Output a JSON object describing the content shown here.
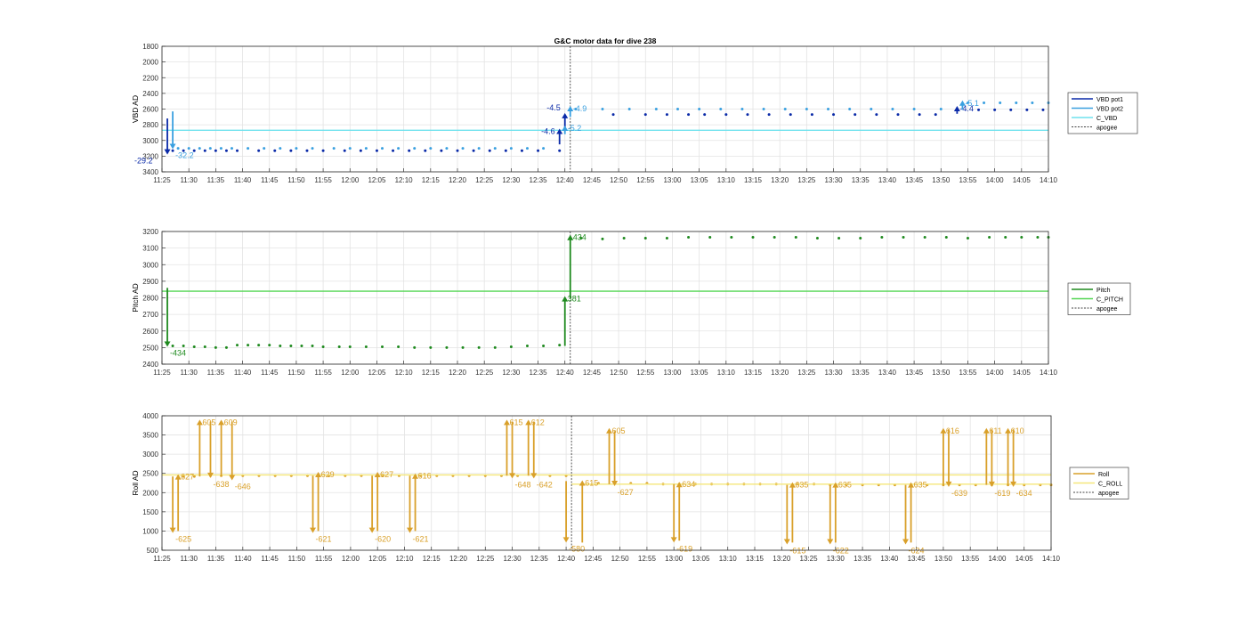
{
  "figure_title": "G&C motor data for dive 238",
  "colors": {
    "vbd_pot1": "#0a2aa8",
    "vbd_pot2": "#3aa0e0",
    "c_vbd": "#6fe2ee",
    "pitch": "#1f8a1f",
    "c_pitch": "#55d655",
    "roll": "#d9a02a",
    "c_roll": "#f5e77a",
    "apogee": "#444444",
    "grid": "#e3e3e3"
  },
  "chart_data": [
    {
      "id": "vbd",
      "type": "scatter",
      "ylabel": "VBD AD",
      "ylim": [
        1800,
        3400
      ],
      "y_reversed": true,
      "yticks": [
        1800,
        2000,
        2200,
        2400,
        2600,
        2800,
        3000,
        3200,
        3400
      ],
      "xlim": [
        "11:25",
        "14:10"
      ],
      "grid": true,
      "legend_placement": "right",
      "legend": [
        "VBD pot1",
        "VBD pot2",
        "C_VBD",
        "apogee"
      ],
      "series": [
        {
          "name": "VBD pot1",
          "x": [
            "11:27",
            "11:29",
            "11:31",
            "11:33",
            "11:35",
            "11:37",
            "11:39",
            "11:43",
            "11:46",
            "11:49",
            "11:52",
            "11:55",
            "11:59",
            "12:02",
            "12:05",
            "12:08",
            "12:11",
            "12:14",
            "12:17",
            "12:20",
            "12:23",
            "12:26",
            "12:29",
            "12:32",
            "12:35",
            "12:39",
            "12:49",
            "12:55",
            "12:59",
            "13:03",
            "13:06",
            "13:10",
            "13:14",
            "13:18",
            "13:22",
            "13:26",
            "13:30",
            "13:34",
            "13:38",
            "13:42",
            "13:46",
            "13:49",
            "13:53",
            "13:57",
            "14:00",
            "14:03",
            "14:06",
            "14:09"
          ],
          "y": [
            3130,
            3130,
            3130,
            3130,
            3130,
            3130,
            3130,
            3130,
            3130,
            3130,
            3130,
            3130,
            3130,
            3130,
            3130,
            3130,
            3130,
            3130,
            3130,
            3130,
            3130,
            3130,
            3130,
            3130,
            3130,
            3130,
            2670,
            2670,
            2670,
            2670,
            2670,
            2670,
            2670,
            2670,
            2670,
            2670,
            2670,
            2670,
            2670,
            2670,
            2670,
            2670,
            2610,
            2610,
            2610,
            2610,
            2610,
            2610
          ]
        },
        {
          "name": "VBD pot2",
          "x": [
            "11:28",
            "11:30",
            "11:32",
            "11:34",
            "11:36",
            "11:38",
            "11:41",
            "11:44",
            "11:47",
            "11:50",
            "11:53",
            "11:57",
            "12:00",
            "12:03",
            "12:06",
            "12:09",
            "12:12",
            "12:15",
            "12:18",
            "12:21",
            "12:24",
            "12:27",
            "12:30",
            "12:33",
            "12:36",
            "12:42",
            "12:47",
            "12:52",
            "12:57",
            "13:01",
            "13:05",
            "13:09",
            "13:13",
            "13:17",
            "13:21",
            "13:25",
            "13:29",
            "13:33",
            "13:37",
            "13:41",
            "13:45",
            "13:50",
            "13:55",
            "13:58",
            "14:01",
            "14:04",
            "14:07",
            "14:10"
          ],
          "y": [
            3100,
            3100,
            3100,
            3100,
            3100,
            3100,
            3100,
            3100,
            3100,
            3100,
            3100,
            3100,
            3100,
            3100,
            3100,
            3100,
            3100,
            3100,
            3100,
            3100,
            3100,
            3100,
            3100,
            3100,
            3100,
            2600,
            2600,
            2600,
            2600,
            2600,
            2600,
            2600,
            2600,
            2600,
            2600,
            2600,
            2600,
            2600,
            2600,
            2600,
            2600,
            2600,
            2520,
            2520,
            2520,
            2520,
            2520,
            2520
          ]
        },
        {
          "name": "C_VBD",
          "x": [
            "11:25",
            "14:10"
          ],
          "y": [
            2870,
            2870
          ]
        }
      ],
      "arrows": [
        {
          "series": "VBD pot1",
          "x": "11:26",
          "from": 2720,
          "to": 3180,
          "label": "-29.2"
        },
        {
          "series": "VBD pot2",
          "x": "11:27",
          "from": 2630,
          "to": 3110,
          "label": "-32.2"
        },
        {
          "series": "VBD pot1",
          "x": "12:39",
          "from": 3050,
          "to": 2850,
          "label": "-4.6"
        },
        {
          "series": "VBD pot1",
          "x": "12:40",
          "from": 2880,
          "to": 2650,
          "label": "-4.5"
        },
        {
          "series": "VBD pot2",
          "x": "12:40",
          "from": 2920,
          "to": 2810,
          "label": "-5.2"
        },
        {
          "series": "VBD pot2",
          "x": "12:41",
          "from": 2700,
          "to": 2560,
          "label": "-4.9"
        },
        {
          "series": "VBD pot1",
          "x": "13:53",
          "from": 2660,
          "to": 2560,
          "label": "-4.4"
        },
        {
          "series": "VBD pot2",
          "x": "13:54",
          "from": 2610,
          "to": 2490,
          "label": "-5.1"
        }
      ],
      "apogee_x": "12:41"
    },
    {
      "id": "pitch",
      "type": "scatter",
      "ylabel": "Pitch AD",
      "ylim": [
        2400,
        3200
      ],
      "yticks": [
        2400,
        2500,
        2600,
        2700,
        2800,
        2900,
        3000,
        3100,
        3200
      ],
      "xlim": [
        "11:25",
        "14:10"
      ],
      "grid": true,
      "legend_placement": "right",
      "legend": [
        "Pitch",
        "C_PITCH",
        "apogee"
      ],
      "series": [
        {
          "name": "Pitch",
          "x": [
            "11:27",
            "11:29",
            "11:31",
            "11:33",
            "11:35",
            "11:37",
            "11:39",
            "11:41",
            "11:43",
            "11:45",
            "11:47",
            "11:49",
            "11:51",
            "11:53",
            "11:55",
            "11:58",
            "12:00",
            "12:03",
            "12:06",
            "12:09",
            "12:12",
            "12:15",
            "12:18",
            "12:21",
            "12:24",
            "12:27",
            "12:30",
            "12:33",
            "12:36",
            "12:39",
            "12:43",
            "12:47",
            "12:51",
            "12:55",
            "12:59",
            "13:03",
            "13:07",
            "13:11",
            "13:15",
            "13:19",
            "13:23",
            "13:27",
            "13:31",
            "13:35",
            "13:39",
            "13:43",
            "13:47",
            "13:51",
            "13:55",
            "13:59",
            "14:02",
            "14:05",
            "14:08",
            "14:10"
          ],
          "y": [
            2510,
            2510,
            2505,
            2505,
            2500,
            2500,
            2515,
            2515,
            2515,
            2515,
            2510,
            2510,
            2510,
            2510,
            2505,
            2505,
            2505,
            2505,
            2505,
            2505,
            2500,
            2500,
            2500,
            2500,
            2500,
            2500,
            2505,
            2510,
            2510,
            2515,
            3160,
            3155,
            3160,
            3160,
            3160,
            3165,
            3165,
            3165,
            3165,
            3165,
            3165,
            3160,
            3160,
            3160,
            3165,
            3165,
            3165,
            3165,
            3160,
            3165,
            3165,
            3165,
            3165,
            3165
          ]
        },
        {
          "name": "C_PITCH",
          "x": [
            "11:25",
            "14:10"
          ],
          "y": [
            2840,
            2840
          ]
        }
      ],
      "arrows": [
        {
          "x": "11:26",
          "from": 2860,
          "to": 2505,
          "label": "-434"
        },
        {
          "x": "12:40",
          "from": 2510,
          "to": 2810,
          "label": "381"
        },
        {
          "x": "12:41",
          "from": 2800,
          "to": 3180,
          "label": "434"
        }
      ],
      "apogee_x": "12:41"
    },
    {
      "id": "roll",
      "type": "scatter",
      "ylabel": "Roll AD",
      "ylim": [
        500,
        4000
      ],
      "yticks": [
        500,
        1000,
        1500,
        2000,
        2500,
        3000,
        3500,
        4000
      ],
      "xlim": [
        "11:25",
        "14:10"
      ],
      "grid": true,
      "legend_placement": "right",
      "legend": [
        "Roll",
        "C_ROLL",
        "apogee"
      ],
      "series": [
        {
          "name": "Roll",
          "x": [
            "11:29",
            "11:31",
            "11:34",
            "11:36",
            "11:40",
            "11:43",
            "11:46",
            "11:49",
            "11:52",
            "11:56",
            "11:59",
            "12:02",
            "12:06",
            "12:09",
            "12:13",
            "12:16",
            "12:19",
            "12:22",
            "12:25",
            "12:28",
            "12:31",
            "12:34",
            "12:37",
            "12:40",
            "12:46",
            "12:49",
            "12:52",
            "12:55",
            "12:58",
            "13:01",
            "13:04",
            "13:07",
            "13:10",
            "13:13",
            "13:16",
            "13:19",
            "13:23",
            "13:26",
            "13:29",
            "13:32",
            "13:35",
            "13:38",
            "13:41",
            "13:44",
            "13:47",
            "13:50",
            "13:53",
            "13:56",
            "13:59",
            "14:02",
            "14:05",
            "14:08",
            "14:10"
          ],
          "y": [
            2420,
            2420,
            2440,
            2440,
            2440,
            2440,
            2440,
            2440,
            2440,
            2440,
            2440,
            2440,
            2440,
            2440,
            2440,
            2440,
            2440,
            2440,
            2440,
            2440,
            2440,
            2440,
            2440,
            2440,
            2240,
            2240,
            2240,
            2240,
            2220,
            2220,
            2220,
            2220,
            2220,
            2220,
            2220,
            2220,
            2220,
            2220,
            2200,
            2200,
            2200,
            2200,
            2200,
            2200,
            2200,
            2200,
            2200,
            2200,
            2200,
            2200,
            2200,
            2200,
            2200
          ]
        },
        {
          "name": "C_ROLL",
          "x": [
            "11:25",
            "14:10"
          ],
          "y": [
            2460,
            2460
          ]
        },
        {
          "name": "C_ROLL",
          "x": [
            "12:41",
            "14:10"
          ],
          "y": [
            2220,
            2220
          ]
        }
      ],
      "arrows": [
        {
          "x": "11:27",
          "from": 2420,
          "to": 950,
          "label": "-625"
        },
        {
          "x": "11:28",
          "from": 1000,
          "to": 2480,
          "label": "627"
        },
        {
          "x": "11:32",
          "from": 2420,
          "to": 3900,
          "label": "605"
        },
        {
          "x": "11:34",
          "from": 3850,
          "to": 2380,
          "label": "-638"
        },
        {
          "x": "11:36",
          "from": 2420,
          "to": 3900,
          "label": "609"
        },
        {
          "x": "11:38",
          "from": 3850,
          "to": 2320,
          "label": "-646"
        },
        {
          "x": "11:53",
          "from": 2440,
          "to": 950,
          "label": "-621"
        },
        {
          "x": "11:54",
          "from": 1000,
          "to": 2540,
          "label": "629"
        },
        {
          "x": "12:04",
          "from": 2440,
          "to": 950,
          "label": "-620"
        },
        {
          "x": "12:05",
          "from": 1000,
          "to": 2540,
          "label": "627"
        },
        {
          "x": "12:11",
          "from": 2440,
          "to": 950,
          "label": "-621"
        },
        {
          "x": "12:12",
          "from": 1000,
          "to": 2500,
          "label": "616"
        },
        {
          "x": "12:29",
          "from": 2440,
          "to": 3900,
          "label": "615"
        },
        {
          "x": "12:30",
          "from": 3850,
          "to": 2370,
          "label": "-648"
        },
        {
          "x": "12:33",
          "from": 2440,
          "to": 3900,
          "label": "612"
        },
        {
          "x": "12:34",
          "from": 3850,
          "to": 2370,
          "label": "-642"
        },
        {
          "x": "12:40",
          "from": 2300,
          "to": 700,
          "label": "-580"
        },
        {
          "x": "12:43",
          "from": 700,
          "to": 2320,
          "label": "615"
        },
        {
          "x": "12:48",
          "from": 2220,
          "to": 3680,
          "label": "605"
        },
        {
          "x": "12:49",
          "from": 3600,
          "to": 2170,
          "label": "-627"
        },
        {
          "x": "13:00",
          "from": 2220,
          "to": 700,
          "label": "-619"
        },
        {
          "x": "13:01",
          "from": 750,
          "to": 2280,
          "label": "634"
        },
        {
          "x": "13:21",
          "from": 2200,
          "to": 650,
          "label": "-615"
        },
        {
          "x": "13:22",
          "from": 700,
          "to": 2270,
          "label": "635"
        },
        {
          "x": "13:29",
          "from": 2200,
          "to": 650,
          "label": "-622"
        },
        {
          "x": "13:30",
          "from": 700,
          "to": 2270,
          "label": "635"
        },
        {
          "x": "13:43",
          "from": 2200,
          "to": 650,
          "label": "-624"
        },
        {
          "x": "13:44",
          "from": 700,
          "to": 2270,
          "label": "635"
        },
        {
          "x": "13:50",
          "from": 2200,
          "to": 3680,
          "label": "616"
        },
        {
          "x": "13:51",
          "from": 3650,
          "to": 2150,
          "label": "-639"
        },
        {
          "x": "13:58",
          "from": 2200,
          "to": 3680,
          "label": "611"
        },
        {
          "x": "13:59",
          "from": 3650,
          "to": 2150,
          "label": "-619"
        },
        {
          "x": "14:02",
          "from": 2200,
          "to": 3680,
          "label": "610"
        },
        {
          "x": "14:03",
          "from": 3650,
          "to": 2150,
          "label": "-634"
        }
      ],
      "apogee_x": "12:41"
    }
  ],
  "xticks": [
    "11:25",
    "11:30",
    "11:35",
    "11:40",
    "11:45",
    "11:50",
    "11:55",
    "12:00",
    "12:05",
    "12:10",
    "12:15",
    "12:20",
    "12:25",
    "12:30",
    "12:35",
    "12:40",
    "12:45",
    "12:50",
    "12:55",
    "13:00",
    "13:05",
    "13:10",
    "13:15",
    "13:20",
    "13:25",
    "13:30",
    "13:35",
    "13:40",
    "13:45",
    "13:50",
    "13:55",
    "14:00",
    "14:05",
    "14:10"
  ]
}
